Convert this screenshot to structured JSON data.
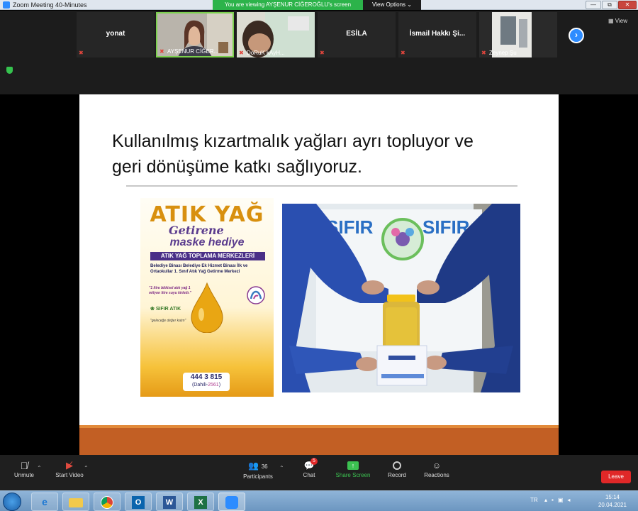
{
  "window": {
    "title": "Zoom Meeting 40-Minutes",
    "banner": "You are viewing AYŞENUR CİĞEROĞLU's screen",
    "view_options": "View Options ⌄",
    "controls": [
      "—",
      "⧉",
      "✕"
    ]
  },
  "gallery": {
    "participants": [
      {
        "name": "yonat",
        "caption": "",
        "video": false
      },
      {
        "name": "",
        "caption": "AYŞENUR CİĞER...",
        "video": true
      },
      {
        "name": "",
        "caption": "DoRuK kAyH...",
        "video": true
      },
      {
        "name": "ESİLA",
        "caption": "",
        "video": false
      },
      {
        "name": "İsmail Hakkı Şi...",
        "caption": "",
        "video": false
      },
      {
        "name": "",
        "caption": "Zeynep Şu",
        "video": true
      }
    ],
    "next_icon": "chevron-right-icon",
    "view_label": "View"
  },
  "slide": {
    "title_line1": "Kullanılmış kızartmalık yağları ayrı topluyor ve",
    "title_line2": "geri dönüşüme katkı sağlıyoruz.",
    "poster": {
      "headline": "ATIK YAĞ",
      "getirene": "Getirene",
      "maske": "maske hediye",
      "band": "ATIK YAĞ TOPLAMA MERKEZLERİ",
      "locations": "Belediye Binası  Belediye Ek Hizmet Binası  İlk ve Ortaokullar  1. Sınıf Atık Yağ Getirme Merkezi",
      "quote": "\"1 litre bitkisel atık yağ 1 milyon litre suyu kirletir.\"",
      "sifir": "SIFIR ATIK",
      "motto": "\"geleceğe değer katın\"",
      "phone": "444 3 815",
      "ext_prefix": "(Dahili-",
      "ext_number": "2561",
      "ext_suffix": ")"
    },
    "photo": {
      "sign_left": "SIFIR",
      "sign_right": "SIFIR"
    }
  },
  "toolbar": {
    "unmute": "Unmute",
    "start_video": "Start Video",
    "participants": "Participants",
    "participants_count": "36",
    "chat": "Chat",
    "chat_badge": "5",
    "share_screen": "Share Screen",
    "record": "Record",
    "reactions": "Reactions",
    "leave": "Leave"
  },
  "taskbar": {
    "apps": [
      "start-orb-icon",
      "internet-explorer-icon",
      "file-explorer-icon",
      "chrome-icon",
      "outlook-icon",
      "word-icon",
      "excel-icon",
      "zoom-icon"
    ],
    "lang": "TR",
    "time": "15:14",
    "date": "20.04.2021"
  },
  "colors": {
    "zoom_blue": "#2d8cff",
    "share_green": "#3cc151",
    "leave_red": "#e02828",
    "slide_orange": "#c25f24"
  }
}
